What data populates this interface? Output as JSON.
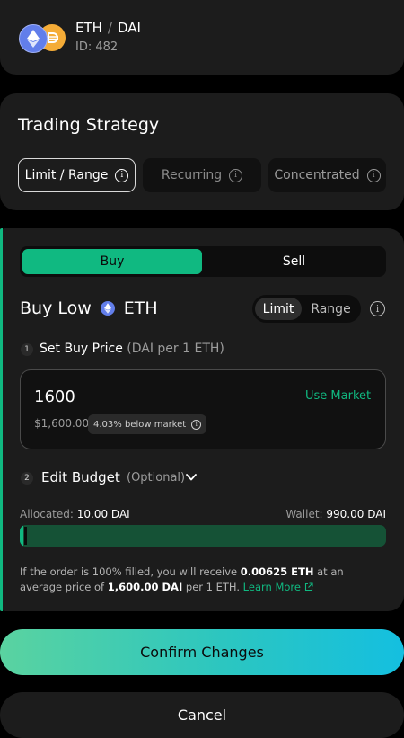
{
  "pair": {
    "base": "ETH",
    "separator": "/",
    "quote": "DAI",
    "id_text": "ID: 482",
    "icons": [
      "eth-icon",
      "dai-icon"
    ]
  },
  "strategy": {
    "title": "Trading Strategy",
    "options": [
      {
        "label": "Limit / Range",
        "selected": true
      },
      {
        "label": "Recurring",
        "selected": false
      },
      {
        "label": "Concentrated",
        "selected": false
      }
    ]
  },
  "order": {
    "tabs": [
      {
        "label": "Buy",
        "selected": true
      },
      {
        "label": "Sell",
        "selected": false
      }
    ],
    "heading_prefix": "Buy Low",
    "heading_token": "ETH",
    "modes": [
      {
        "label": "Limit",
        "selected": true
      },
      {
        "label": "Range",
        "selected": false
      }
    ],
    "step1": {
      "number": "1",
      "label": "Set Buy Price",
      "sublabel": "(DAI per 1 ETH)",
      "price": "1600",
      "use_market": "Use Market",
      "usd_value": "$1,600.00",
      "market_badge": "4.03% below market"
    },
    "step2": {
      "number": "2",
      "label": "Edit Budget",
      "optional": "(Optional)"
    },
    "budget": {
      "allocated_label": "Allocated:",
      "allocated_value": "10.00 DAI",
      "wallet_label": "Wallet:",
      "wallet_value": "990.00 DAI",
      "fill_fraction": 0.01
    },
    "summary": {
      "part1": "If the order is 100% filled, you will receive ",
      "receive": "0.00625 ETH",
      "part2": " at an average price of ",
      "price": "1,600.00 DAI",
      "part3": " per 1 ETH. ",
      "learn_more": "Learn More"
    }
  },
  "actions": {
    "confirm": "Confirm Changes",
    "cancel": "Cancel"
  },
  "colors": {
    "accent": "#10b981",
    "card": "#1c1c1c",
    "background": "#000000",
    "eth": "#627eea",
    "dai": "#f5ac37"
  }
}
